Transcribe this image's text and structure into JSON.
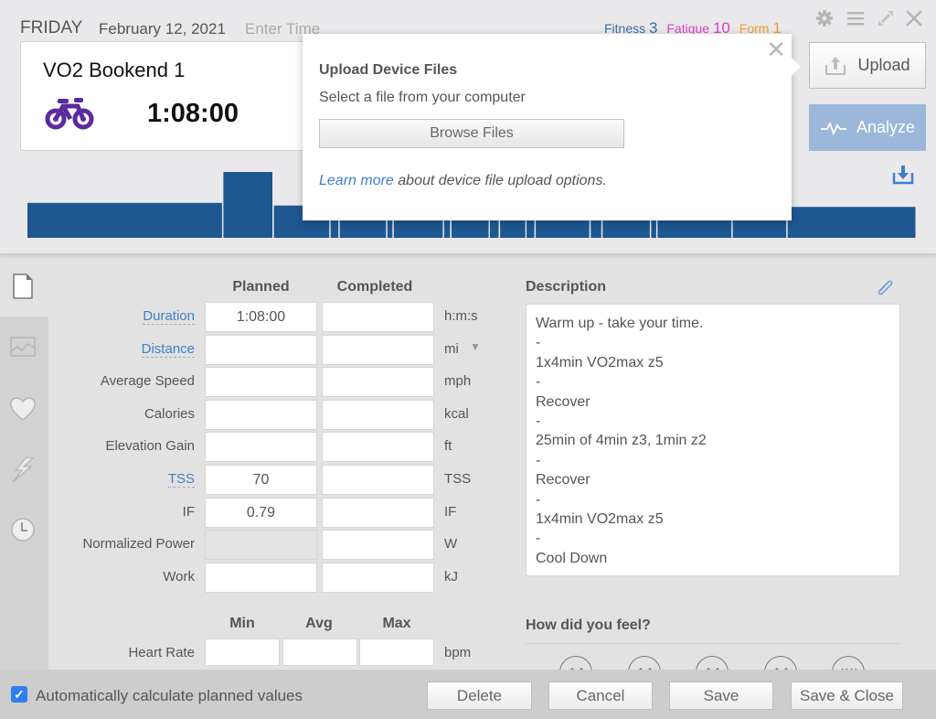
{
  "header": {
    "day": "FRIDAY",
    "date": "February 12, 2021",
    "enter_time_placeholder": "Enter Time",
    "metrics": {
      "fitness_label": "Fitness",
      "fitness_value": "3",
      "fatigue_label": "Fatigue",
      "fatigue_value": "10",
      "form_label": "Form",
      "form_value": "1"
    },
    "window_icons": [
      "gear-icon",
      "menu-icon",
      "expand-icon",
      "close-icon"
    ]
  },
  "workout": {
    "title": "VO2 Bookend 1",
    "sport_icon": "bike-icon",
    "sport_color": "#5b2a9c",
    "duration": "1:08:00"
  },
  "actions": {
    "upload_label": "Upload",
    "analyze_label": "Analyze",
    "download_icon": "download-icon"
  },
  "popover": {
    "title": "Upload Device Files",
    "subtitle": "Select a file from your computer",
    "browse_label": "Browse Files",
    "learn_more_link": "Learn more",
    "learn_more_rest": " about device file upload options."
  },
  "workout_profile": {
    "bar_color": "#1f5791",
    "segments": [
      {
        "duration": 214,
        "intensity": 0.53
      },
      {
        "duration": 55,
        "intensity": 1.0
      },
      {
        "duration": 62,
        "intensity": 0.49
      },
      {
        "duration": 10,
        "intensity": 0.49
      },
      {
        "duration": 52,
        "intensity": 0.49
      },
      {
        "duration": 7,
        "intensity": 0.49
      },
      {
        "duration": 55,
        "intensity": 0.49
      },
      {
        "duration": 8,
        "intensity": 0.49
      },
      {
        "duration": 42,
        "intensity": 0.49
      },
      {
        "duration": 11,
        "intensity": 0.49
      },
      {
        "duration": 29,
        "intensity": 0.49
      },
      {
        "duration": 10,
        "intensity": 0.49
      },
      {
        "duration": 60,
        "intensity": 0.49
      },
      {
        "duration": 13,
        "intensity": 0.49
      },
      {
        "duration": 53,
        "intensity": 0.49
      },
      {
        "duration": 7,
        "intensity": 0.49
      },
      {
        "duration": 82,
        "intensity": 0.49
      },
      {
        "duration": 60,
        "intensity": 0.49
      },
      {
        "duration": 141,
        "intensity": 0.47
      }
    ]
  },
  "side_nav": [
    "summary-icon",
    "chart-icon",
    "heart-icon",
    "power-icon",
    "clock-icon"
  ],
  "form": {
    "col_planned": "Planned",
    "col_completed": "Completed",
    "rows": [
      {
        "label": "Duration",
        "link": true,
        "planned": "1:08:00",
        "completed": "",
        "unit": "h:m:s"
      },
      {
        "label": "Distance",
        "link": true,
        "planned": "",
        "completed": "",
        "unit": "mi"
      },
      {
        "label": "Average Speed",
        "link": false,
        "planned": "",
        "completed": "",
        "unit": "mph"
      },
      {
        "label": "Calories",
        "link": false,
        "planned": "",
        "completed": "",
        "unit": "kcal"
      },
      {
        "label": "Elevation Gain",
        "link": false,
        "planned": "",
        "completed": "",
        "unit": "ft"
      },
      {
        "label": "TSS",
        "link": true,
        "planned": "70",
        "completed": "",
        "unit": "TSS"
      },
      {
        "label": "IF",
        "link": false,
        "planned": "0.79",
        "completed": "",
        "unit": "IF"
      },
      {
        "label": "Normalized Power",
        "link": false,
        "planned": "",
        "completed": "",
        "unit": "W",
        "planned_disabled": true
      },
      {
        "label": "Work",
        "link": false,
        "planned": "",
        "completed": "",
        "unit": "kJ"
      }
    ],
    "hr": {
      "col_min": "Min",
      "col_avg": "Avg",
      "col_max": "Max",
      "label": "Heart Rate",
      "min": "",
      "avg": "",
      "max": "",
      "unit": "bpm"
    }
  },
  "description": {
    "title": "Description",
    "text": "Warm up - take your time.\n-\n1x4min VO2max z5\n-\nRecover\n-\n25min of 4min z3, 1min z2\n-\nRecover\n-\n1x4min VO2max z5\n-\nCool Down"
  },
  "feel": {
    "title": "How did you feel?"
  },
  "footer": {
    "auto_calc_label": "Automatically calculate planned values",
    "auto_calc_checked": true,
    "delete_label": "Delete",
    "cancel_label": "Cancel",
    "save_label": "Save",
    "save_close_label": "Save & Close"
  }
}
